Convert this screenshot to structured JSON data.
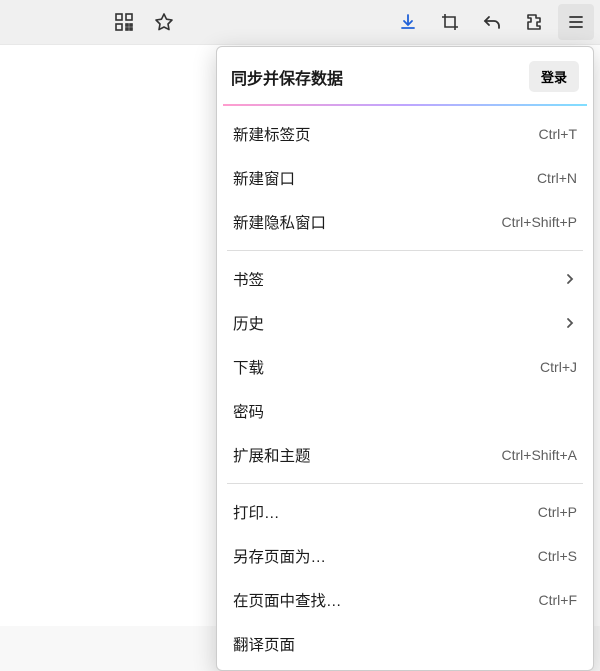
{
  "toolbar": {
    "icons": {
      "qr": "qr-icon",
      "star": "star-icon",
      "download": "download-icon",
      "crop": "screenshot-icon",
      "back": "undo-icon",
      "extension": "extensions-icon",
      "menu": "hamburger-icon"
    }
  },
  "menu": {
    "sync": {
      "title": "同步并保存数据",
      "login": "登录"
    },
    "group1": [
      {
        "label": "新建标签页",
        "shortcut": "Ctrl+T"
      },
      {
        "label": "新建窗口",
        "shortcut": "Ctrl+N"
      },
      {
        "label": "新建隐私窗口",
        "shortcut": "Ctrl+Shift+P"
      }
    ],
    "group2": [
      {
        "label": "书签",
        "submenu": true
      },
      {
        "label": "历史",
        "submenu": true
      },
      {
        "label": "下载",
        "shortcut": "Ctrl+J"
      },
      {
        "label": "密码"
      },
      {
        "label": "扩展和主题",
        "shortcut": "Ctrl+Shift+A"
      }
    ],
    "group3": [
      {
        "label": "打印…",
        "shortcut": "Ctrl+P"
      },
      {
        "label": "另存页面为…",
        "shortcut": "Ctrl+S"
      },
      {
        "label": "在页面中查找…",
        "shortcut": "Ctrl+F"
      },
      {
        "label": "翻译页面"
      }
    ]
  }
}
